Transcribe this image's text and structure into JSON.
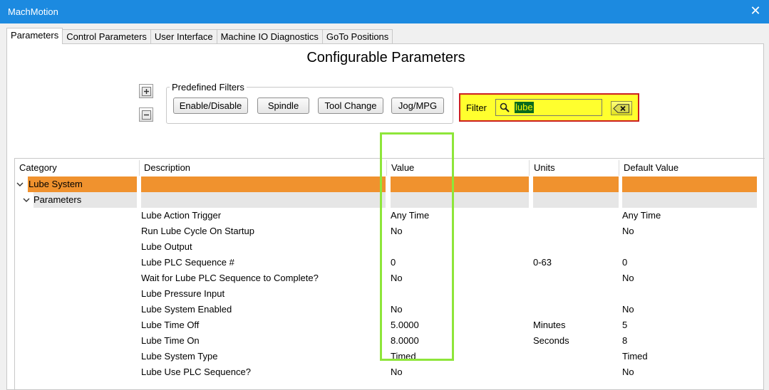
{
  "window": {
    "title": "MachMotion"
  },
  "tabs": [
    {
      "label": "Parameters",
      "active": true
    },
    {
      "label": "Control Parameters",
      "active": false
    },
    {
      "label": "User Interface",
      "active": false
    },
    {
      "label": "Machine IO Diagnostics",
      "active": false
    },
    {
      "label": "GoTo Positions",
      "active": false
    }
  ],
  "page": {
    "title": "Configurable Parameters"
  },
  "predefined_filters": {
    "label": "Predefined Filters",
    "buttons": [
      "Enable/Disable",
      "Spindle",
      "Tool Change",
      "Jog/MPG"
    ]
  },
  "filter": {
    "label": "Filter",
    "value": "lube"
  },
  "table": {
    "columns": [
      "Category",
      "Description",
      "Value",
      "Units",
      "Default Value"
    ],
    "category": "Lube System",
    "subcategory": "Parameters",
    "rows": [
      {
        "description": "Lube Action Trigger",
        "value": "Any Time",
        "units": "",
        "default": "Any Time"
      },
      {
        "description": "Run Lube Cycle On Startup",
        "value": "No",
        "units": "",
        "default": "No"
      },
      {
        "description": "Lube Output",
        "value": "",
        "units": "",
        "default": ""
      },
      {
        "description": "Lube PLC Sequence #",
        "value": "0",
        "units": "0-63",
        "default": "0"
      },
      {
        "description": "Wait for Lube PLC Sequence to Complete?",
        "value": "No",
        "units": "",
        "default": "No"
      },
      {
        "description": "Lube Pressure Input",
        "value": "",
        "units": "",
        "default": ""
      },
      {
        "description": "Lube System Enabled",
        "value": "No",
        "units": "",
        "default": "No"
      },
      {
        "description": "Lube Time Off",
        "value": "5.0000",
        "units": "Minutes",
        "default": "5"
      },
      {
        "description": "Lube Time On",
        "value": "8.0000",
        "units": "Seconds",
        "default": "8"
      },
      {
        "description": "Lube System Type",
        "value": "Timed",
        "units": "",
        "default": "Timed"
      },
      {
        "description": "Lube Use PLC Sequence?",
        "value": "No",
        "units": "",
        "default": "No"
      }
    ]
  },
  "colors": {
    "titlebar": "#1c8ae0",
    "category_row": "#f0922e",
    "subcategory_row": "#e6e6e6",
    "filter_highlight": "#ffff2e",
    "filter_border": "#cc1f1f",
    "value_column_highlight": "#8ee63a"
  },
  "icons": {
    "close": "close-icon",
    "expand_all": "plus-icon",
    "collapse_all": "minus-icon",
    "search": "search-icon",
    "clear": "backspace-clear-icon",
    "tree_expanded": "chevron-down-icon"
  }
}
